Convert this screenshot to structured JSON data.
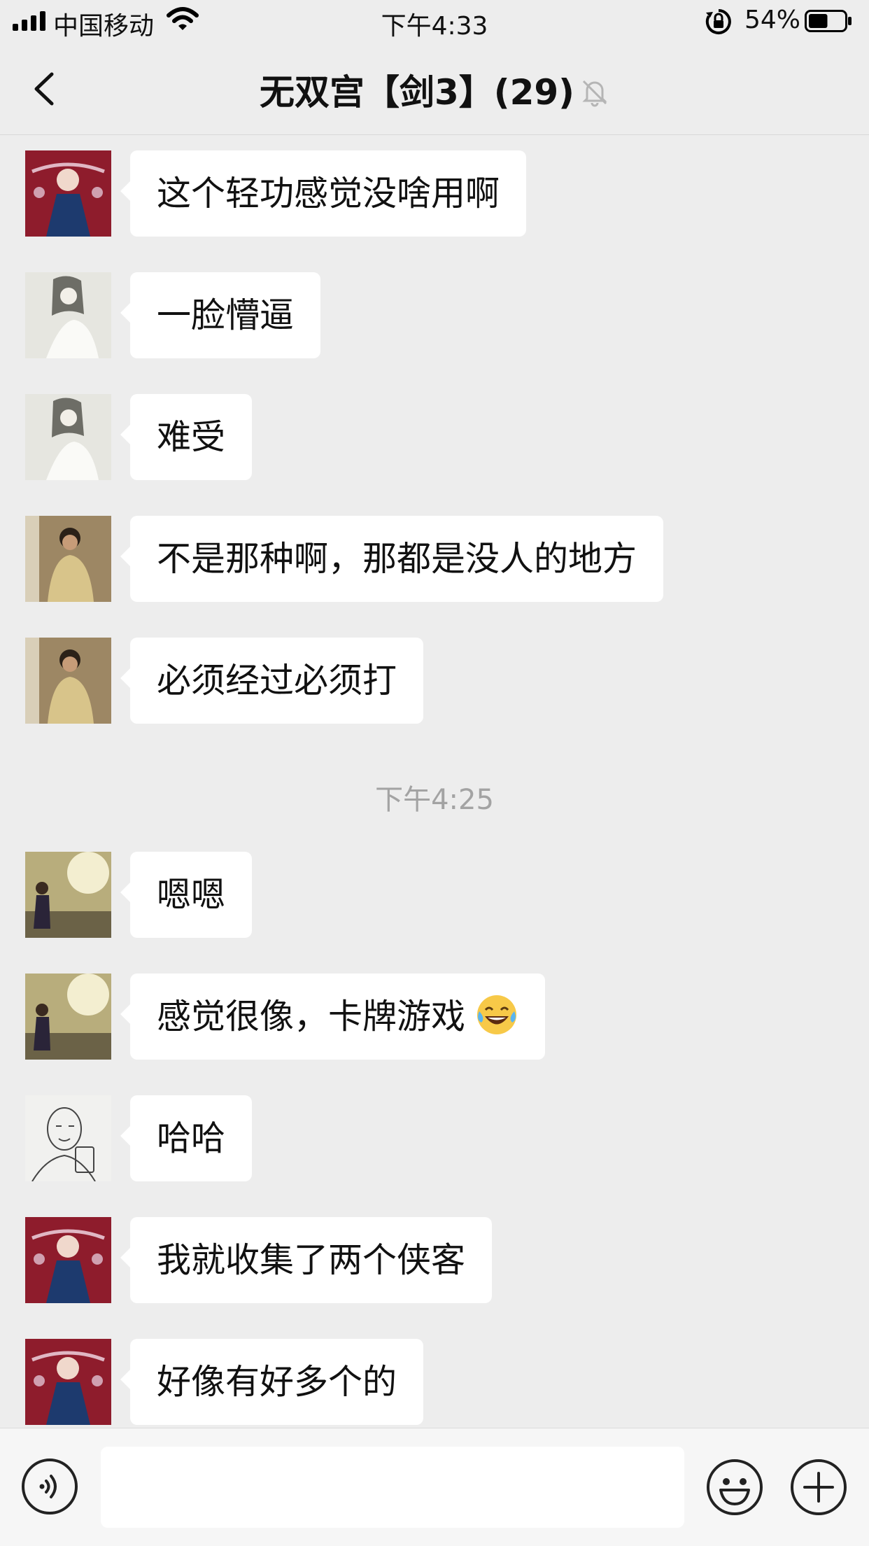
{
  "status_bar": {
    "carrier": "中国移动",
    "time": "下午4:33",
    "battery_percent": "54%",
    "battery_level": 0.54
  },
  "nav": {
    "title": "无双宫【剑3】(29)"
  },
  "messages": [
    {
      "text": "这个轻功感觉没啥用啊",
      "avatar": "red-warrior-avatar"
    },
    {
      "text": "一脸懵逼",
      "avatar": "ink-painting-avatar"
    },
    {
      "text": "难受",
      "avatar": "ink-painting-avatar"
    },
    {
      "text": "不是那种啊，那都是没人的地方",
      "avatar": "mirror-selfie-avatar"
    },
    {
      "text": "必须经过必须打",
      "avatar": "mirror-selfie-avatar"
    },
    {
      "text": "嗯嗯",
      "avatar": "outdoor-photo-avatar"
    },
    {
      "text": "感觉很像，卡牌游戏",
      "avatar": "outdoor-photo-avatar",
      "emoji": "tears-of-joy-emoji"
    },
    {
      "text": "哈哈",
      "avatar": "sketch-face-avatar"
    },
    {
      "text": "我就收集了两个侠客",
      "avatar": "red-warrior-avatar"
    },
    {
      "text": "好像有好多个的",
      "avatar": "red-warrior-avatar"
    }
  ],
  "time_separator": "下午4:25",
  "input": {
    "value": "",
    "icons": [
      "voice-icon",
      "emoji-icon",
      "plus-icon"
    ]
  }
}
